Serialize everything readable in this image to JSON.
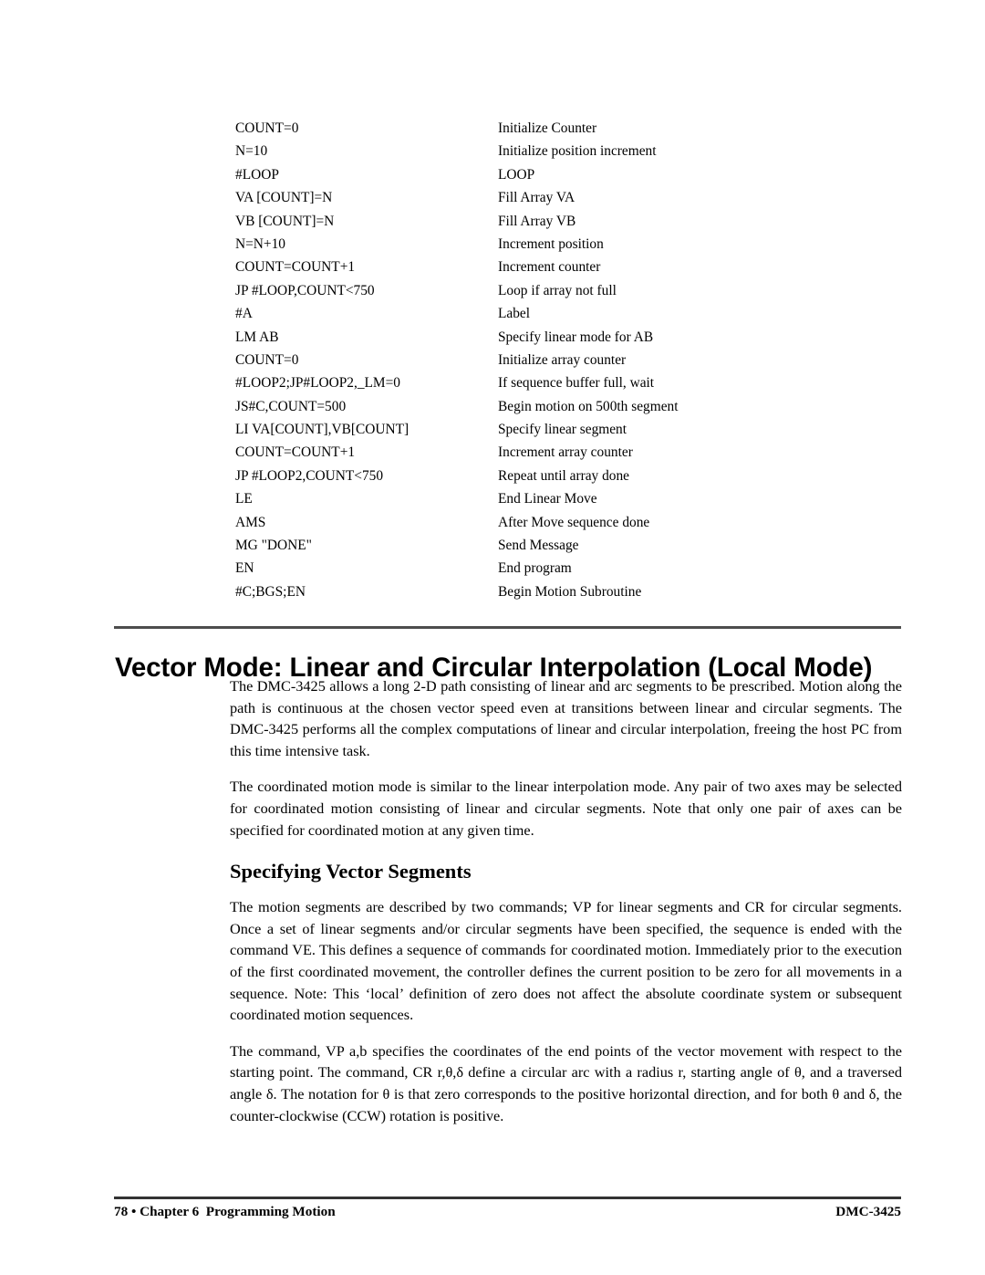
{
  "code_listing": [
    {
      "command": "COUNT=0",
      "description": "Initialize Counter"
    },
    {
      "command": "N=10",
      "description": "Initialize position increment"
    },
    {
      "command": "#LOOP",
      "description": "LOOP"
    },
    {
      "command": "VA [COUNT]=N",
      "description": "Fill Array VA"
    },
    {
      "command": "VB [COUNT]=N",
      "description": "Fill Array VB"
    },
    {
      "command": "N=N+10",
      "description": "Increment position"
    },
    {
      "command": "COUNT=COUNT+1",
      "description": "Increment counter"
    },
    {
      "command": "JP #LOOP,COUNT<750",
      "description": "Loop if array not full"
    },
    {
      "command": "#A",
      "description": "Label"
    },
    {
      "command": "LM AB",
      "description": "Specify linear mode for AB"
    },
    {
      "command": "COUNT=0",
      "description": "Initialize array counter"
    },
    {
      "command": "#LOOP2;JP#LOOP2,_LM=0",
      "description": "If sequence buffer full, wait"
    },
    {
      "command": "JS#C,COUNT=500",
      "description": "Begin motion on 500th segment"
    },
    {
      "command": "LI VA[COUNT],VB[COUNT]",
      "description": "Specify linear segment"
    },
    {
      "command": "COUNT=COUNT+1",
      "description": "Increment array counter"
    },
    {
      "command": "JP #LOOP2,COUNT<750",
      "description": "Repeat until array done"
    },
    {
      "command": "LE",
      "description": "End Linear Move"
    },
    {
      "command": "AMS",
      "description": "After Move sequence done"
    },
    {
      "command": "MG \"DONE\"",
      "description": "Send Message"
    },
    {
      "command": "EN",
      "description": "End program"
    },
    {
      "command": "#C;BGS;EN",
      "description": "Begin Motion Subroutine"
    }
  ],
  "heading": {
    "main": "Vector Mode: Linear and Circular Interpolation (Local Mode)",
    "sub": "Specifying Vector Segments"
  },
  "paragraphs": {
    "p1": "The DMC-3425 allows a long 2-D path consisting of linear and arc segments to be prescribed.  Motion along the path is continuous at the chosen vector speed even at transitions between linear and circular segments.  The DMC-3425 performs all the complex computations of linear and circular interpolation, freeing the host PC from this time intensive task.",
    "p2": "The coordinated motion mode is similar to the linear interpolation mode.  Any pair of two axes may be selected for coordinated motion consisting of linear and circular segments.  Note that only one pair of axes can be specified for coordinated motion at any given time.",
    "p3": "The motion segments are described by two commands; VP for linear segments and CR for circular segments.  Once a set of linear segments and/or circular segments have been specified, the sequence is ended with the command VE.  This defines a sequence of commands for coordinated motion.  Immediately prior to the execution of the first coordinated movement, the controller defines the current position to be zero for all movements in a sequence.  Note:  This ‘local’ definition of zero does not affect the absolute coordinate system or subsequent coordinated motion sequences.",
    "p4": "The command, VP a,b specifies the coordinates of the end points of the vector movement with respect to the starting point.  The command, CR r,θ,δ define a circular arc with a radius r, starting angle of θ, and a traversed angle δ.  The notation for θ is that zero corresponds to the positive horizontal direction, and for both θ and δ, the counter-clockwise (CCW) rotation is positive."
  },
  "footer": {
    "left": "78 • Chapter 6  Programming Motion",
    "right": "DMC-3425"
  },
  "colors": {
    "text": "#000000",
    "rule": "#4d4d4d",
    "background": "#ffffff"
  }
}
